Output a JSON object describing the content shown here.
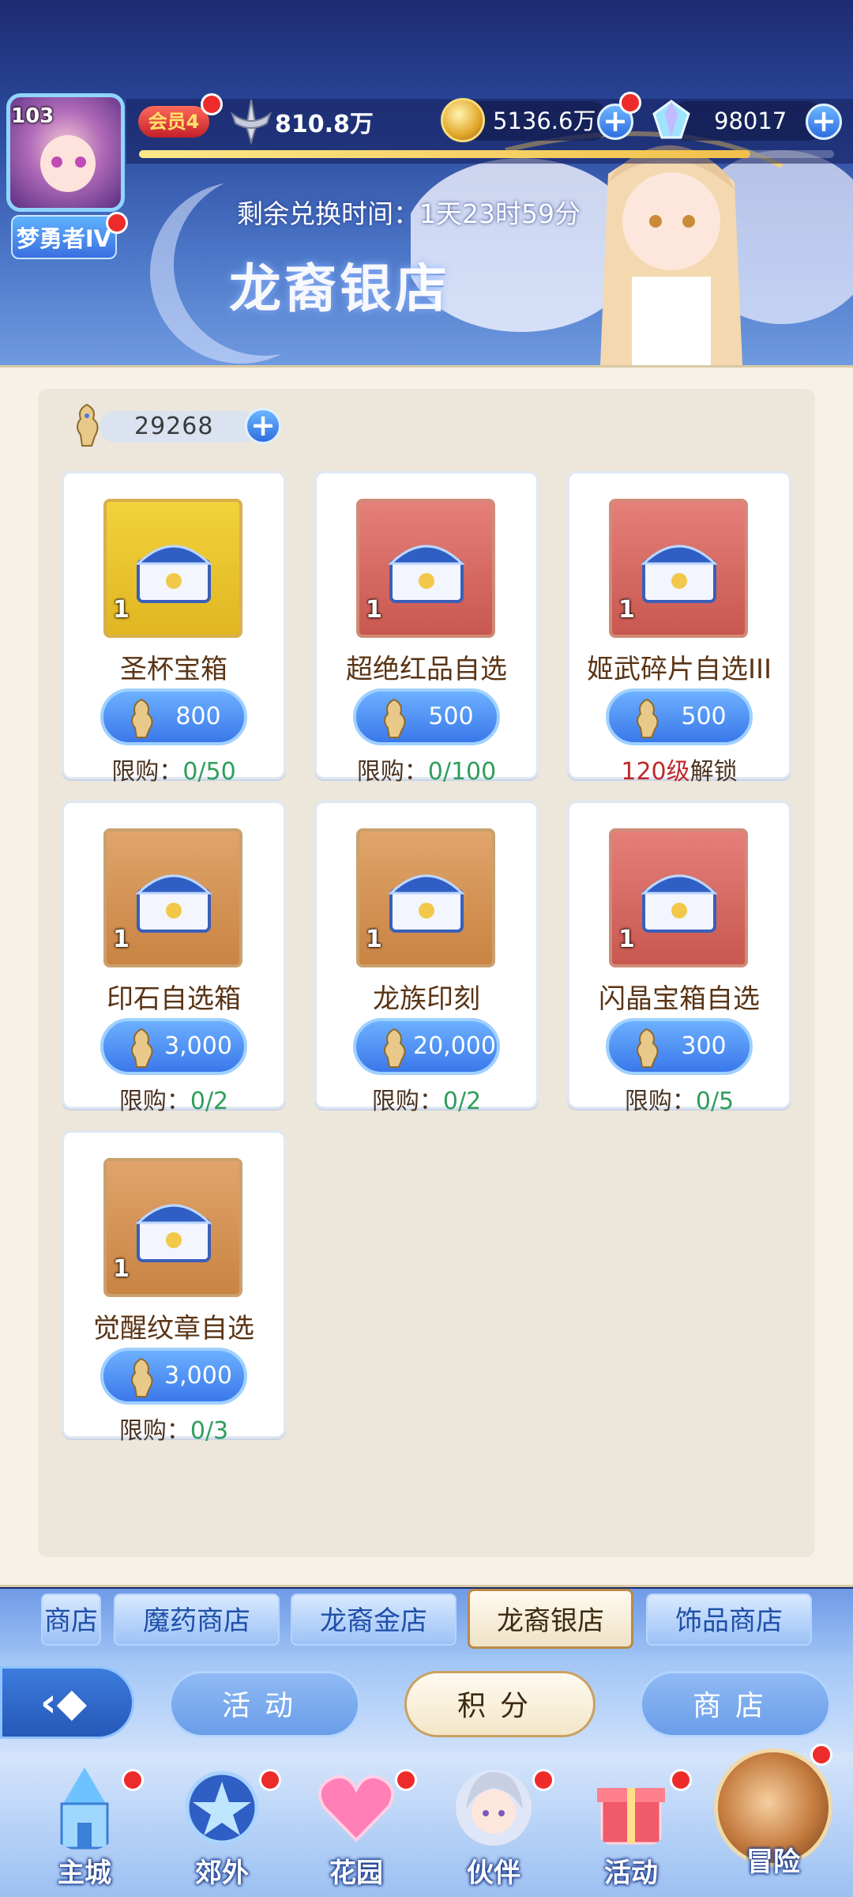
{
  "header": {
    "level": "103",
    "rank": "梦勇者IV",
    "vip": "会员4",
    "power": "810.8万",
    "gold": "5136.6万",
    "diamonds": "98017",
    "xp_progress": 0.88,
    "countdown": "剩余兑换时间：1天23时59分",
    "shop_title": "龙裔银店"
  },
  "shop": {
    "currency_balance": "29268",
    "items": [
      {
        "name": "圣杯宝箱",
        "qty": "1",
        "price": "800",
        "limit_label": "限购：",
        "limit_value": "0/50",
        "frame": "gold"
      },
      {
        "name": "超绝红品自选",
        "qty": "1",
        "price": "500",
        "limit_label": "限购：",
        "limit_value": "0/100",
        "frame": "red"
      },
      {
        "name": "姬武碎片自选III",
        "qty": "1",
        "price": "500",
        "limit_label": "120级",
        "limit_value": "解锁",
        "frame": "red",
        "badge": "III"
      },
      {
        "name": "印石自选箱",
        "qty": "1",
        "price": "3,000",
        "limit_label": "限购：",
        "limit_value": "0/2",
        "frame": "orange"
      },
      {
        "name": "龙族印刻",
        "qty": "1",
        "price": "20,000",
        "limit_label": "限购：",
        "limit_value": "0/2",
        "frame": "orange"
      },
      {
        "name": "闪晶宝箱自选",
        "qty": "1",
        "price": "300",
        "limit_label": "限购：",
        "limit_value": "0/5",
        "frame": "red"
      },
      {
        "name": "觉醒纹章自选",
        "qty": "1",
        "price": "3,000",
        "limit_label": "限购：",
        "limit_value": "0/3",
        "frame": "orange"
      }
    ]
  },
  "tabs": [
    "商店",
    "魔药商店",
    "龙裔金店",
    "龙裔银店",
    "饰品商店"
  ],
  "active_tab": "龙裔银店",
  "sections": {
    "activity": "活动",
    "points": "积分",
    "store": "商店"
  },
  "nav": {
    "main_city": "主城",
    "outskirts": "郊外",
    "garden": "花园",
    "partner": "伙伴",
    "activity": "活动",
    "adventure": "冒险"
  },
  "icons": {
    "back": "back-chevron-icon",
    "plus": "plus-icon",
    "currency": "dragon-token-icon"
  },
  "colors": {
    "accent_blue": "#3a78ea",
    "limit_green": "#2f9e5a",
    "lock_red": "#c0282a",
    "item_name_brown": "#5a3415"
  }
}
